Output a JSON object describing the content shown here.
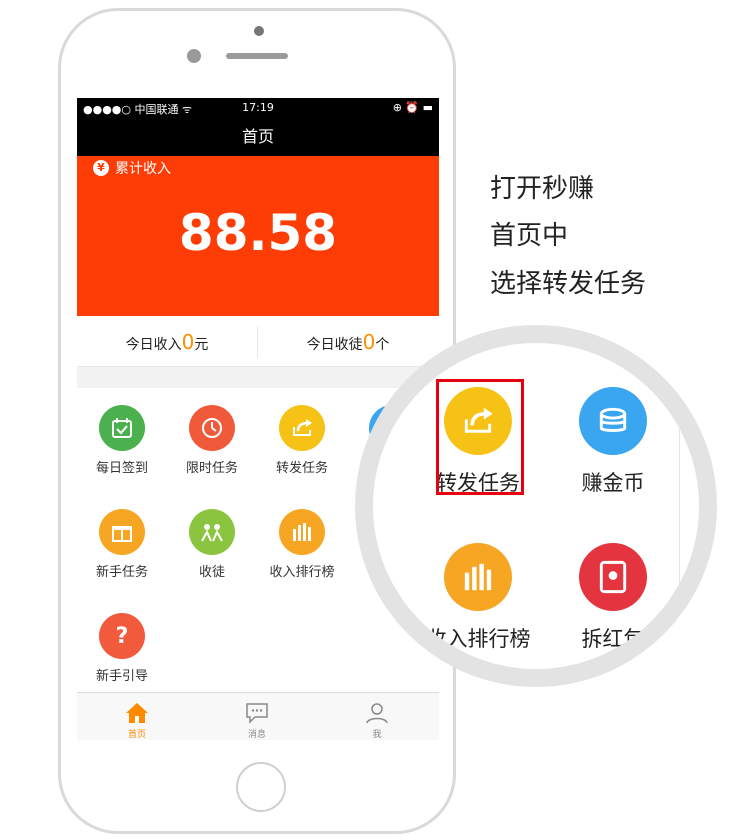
{
  "statusbar": {
    "carrier": "●●●●○ 中国联通 ᯤ",
    "time": "17:19",
    "right": "⊕ ⏰ ▬"
  },
  "navbar": {
    "title": "首页"
  },
  "banner": {
    "label": "累计收入",
    "amount": "88.58"
  },
  "stats": {
    "today_income_label": "今日收入",
    "today_income_value": "0",
    "today_income_unit": "元",
    "today_apprentice_label": "今日收徒",
    "today_apprentice_value": "0",
    "today_apprentice_unit": "个"
  },
  "grid": {
    "items": [
      {
        "label": "每日签到",
        "icon": "calendar-check-icon",
        "color": "#4bb14e"
      },
      {
        "label": "限时任务",
        "icon": "timer-icon",
        "color": "#f05a3b"
      },
      {
        "label": "转发任务",
        "icon": "share-icon",
        "color": "#f6c215"
      },
      {
        "label": "赚",
        "icon": "coins-icon",
        "color": "#3aa6f0"
      },
      {
        "label": "新手任务",
        "icon": "gift-icon",
        "color": "#f6a623"
      },
      {
        "label": "收徒",
        "icon": "people-icon",
        "color": "#8bc53f"
      },
      {
        "label": "收入排行榜",
        "icon": "bar-chart-icon",
        "color": "#f6a623"
      },
      {
        "label": "拆",
        "icon": "red-envelope-icon",
        "color": "#e3343f"
      },
      {
        "label": "新手引导",
        "icon": "question-icon",
        "color": "#f25a3c"
      }
    ]
  },
  "tabbar": {
    "home": "首页",
    "messages": "消息",
    "me": "我"
  },
  "caption": {
    "line1": "打开秒赚",
    "line2": "首页中",
    "line3": "选择转发任务"
  },
  "zoom": {
    "share_label": "转发任务",
    "coins_label": "赚金币",
    "ranking_label": "收入排行榜",
    "envelope_label": "拆红包"
  },
  "colors": {
    "accent": "#fe3c05",
    "highlight": "#ff9000",
    "tab_active": "#ff8a00",
    "marker": "#e60012"
  }
}
